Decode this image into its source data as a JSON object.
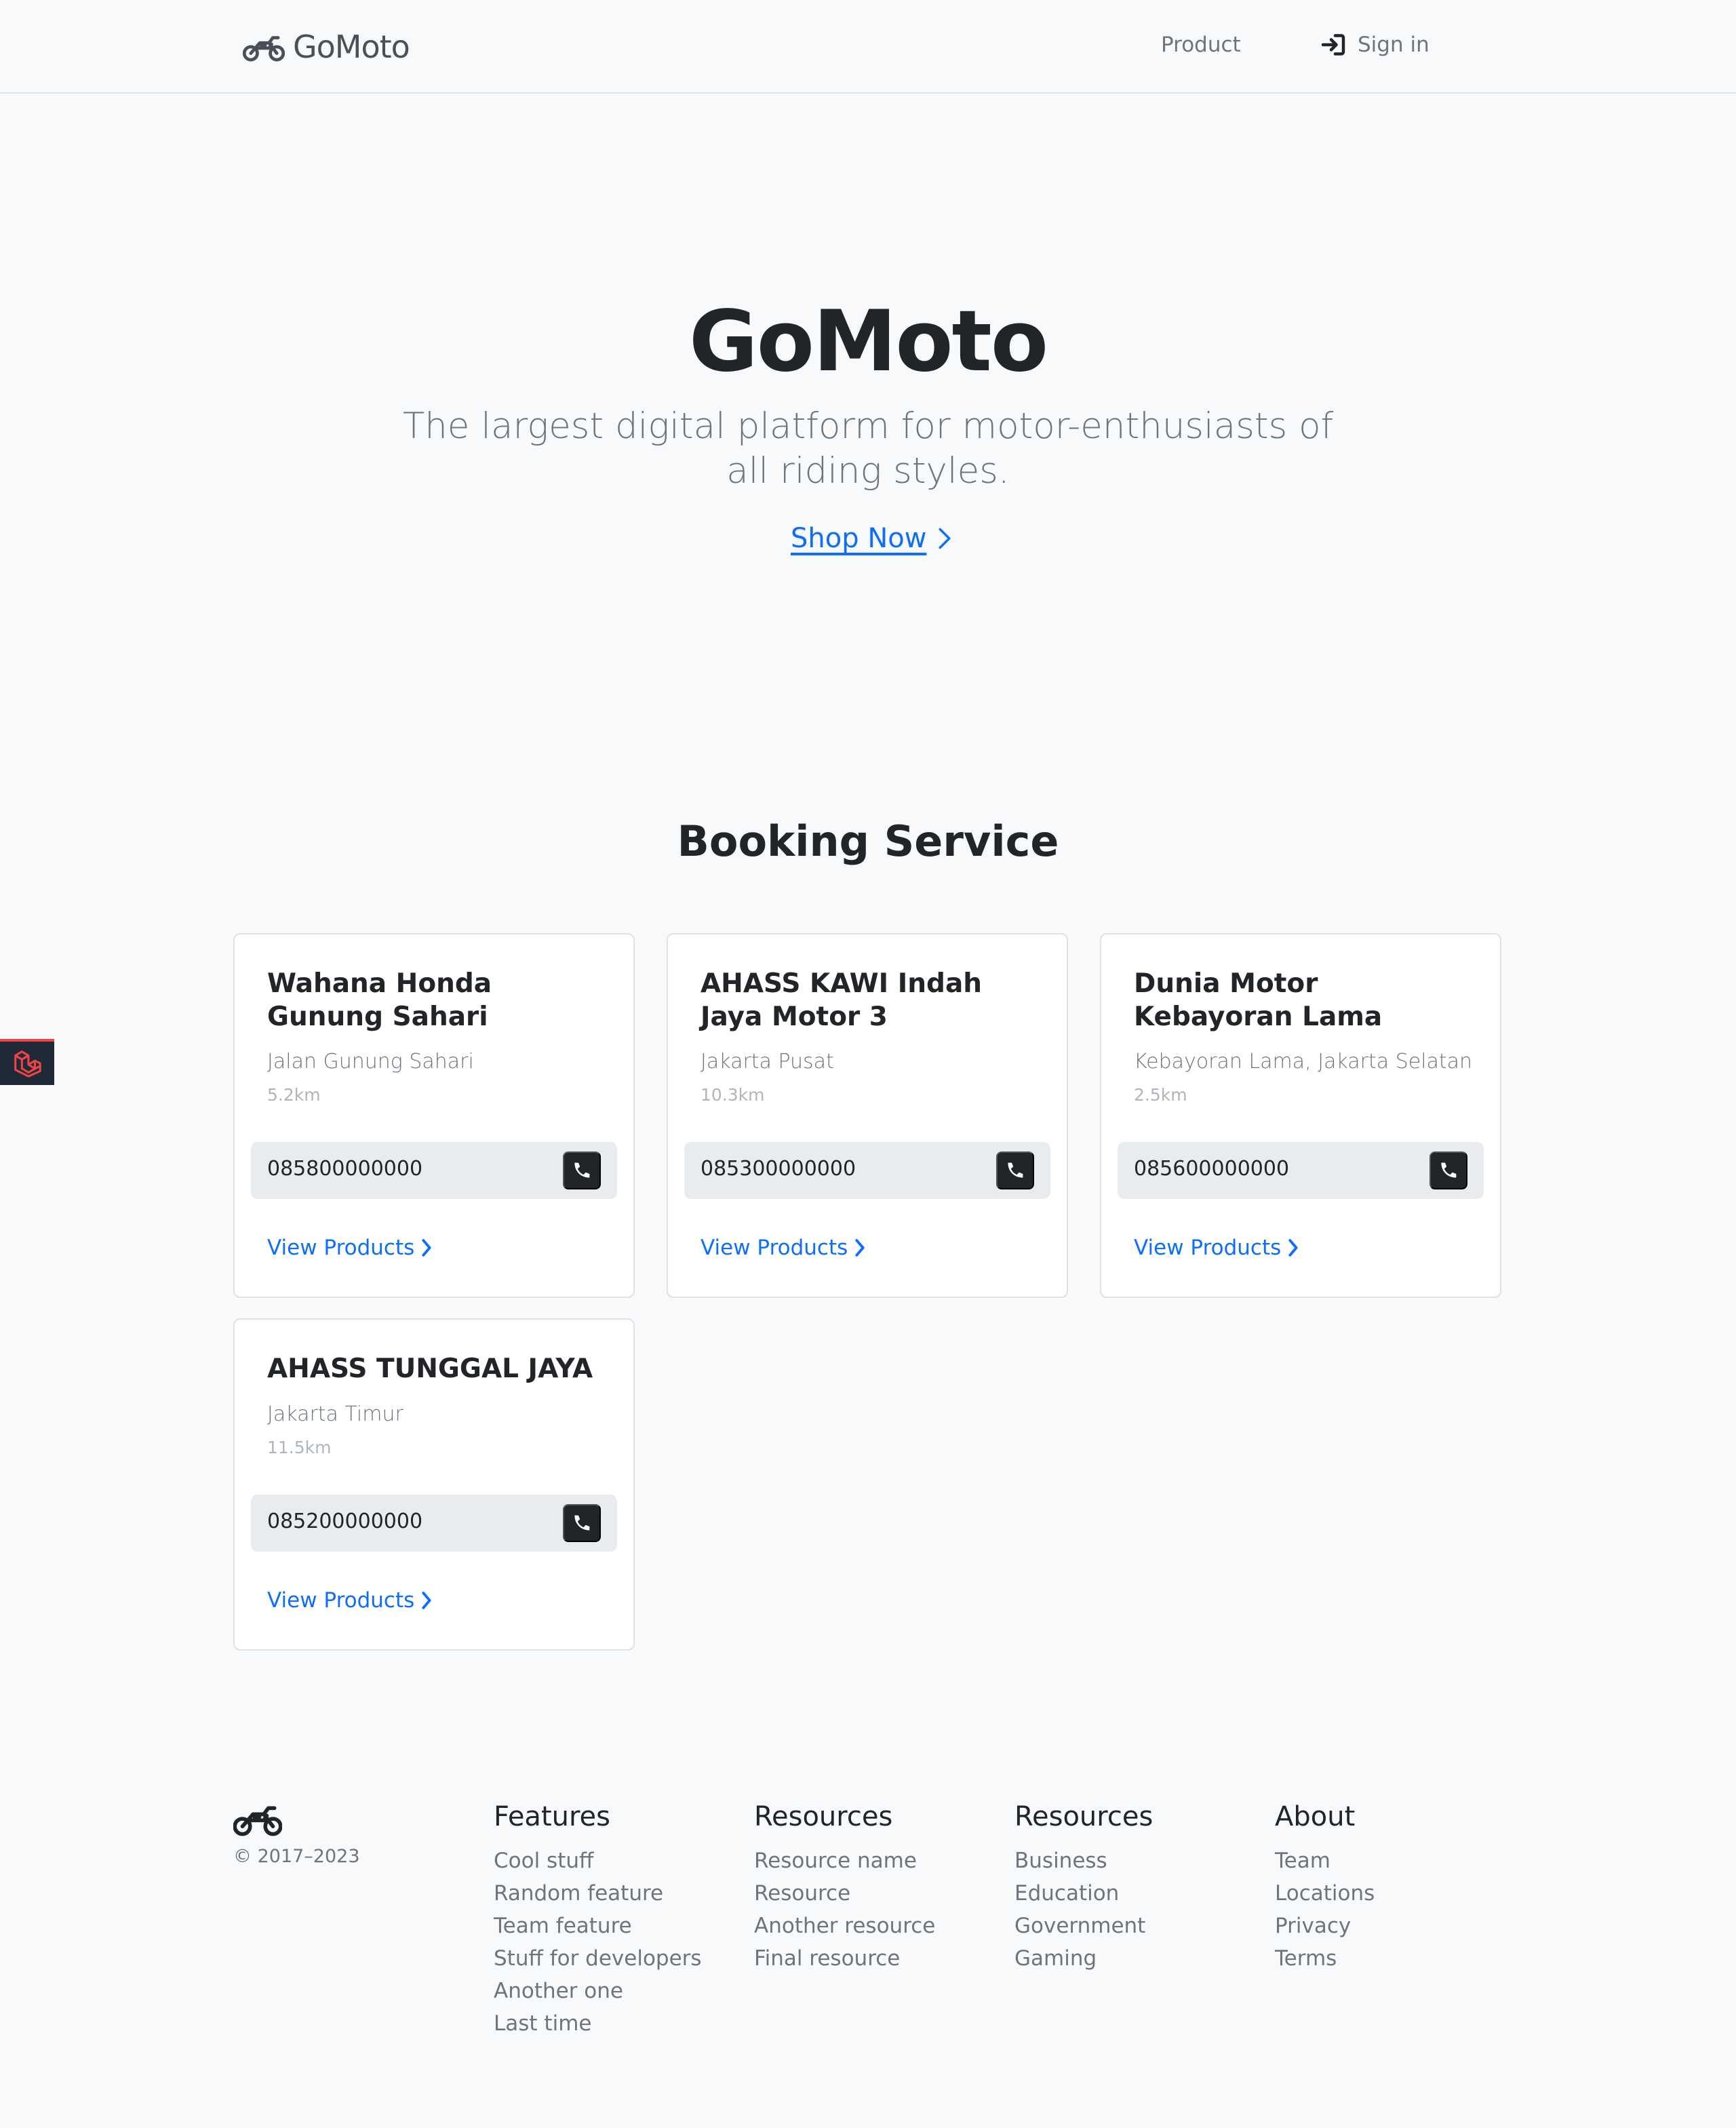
{
  "navbar": {
    "brand": "GoMoto",
    "brand_icon": "motorcycle-icon",
    "links": [
      {
        "label": "Product"
      },
      {
        "label": "Sign in",
        "icon": "sign-in-icon"
      }
    ]
  },
  "hero": {
    "title": "GoMoto",
    "lead": "The largest digital platform for motor-enthusiasts of all riding styles.",
    "cta": "Shop Now",
    "cta_icon": "chevron-right-icon"
  },
  "booking": {
    "title": "Booking Service",
    "cards": [
      {
        "name": "Wahana Honda Gunung Sahari",
        "address": "Jalan Gunung Sahari",
        "distance": "5.2km",
        "phone": "085800000000",
        "link": "View Products"
      },
      {
        "name": "AHASS KAWI Indah Jaya Motor 3",
        "address": "Jakarta Pusat",
        "distance": "10.3km",
        "phone": "085300000000",
        "link": "View Products"
      },
      {
        "name": "Dunia Motor Kebayoran Lama",
        "address": "Kebayoran Lama, Jakarta Selatan",
        "distance": "2.5km",
        "phone": "085600000000",
        "link": "View Products"
      },
      {
        "name": "AHASS TUNGGAL JAYA",
        "address": "Jakarta Timur",
        "distance": "11.5km",
        "phone": "085200000000",
        "link": "View Products"
      }
    ]
  },
  "footer": {
    "copyright": "© 2017–2023",
    "columns": [
      {
        "title": "Features",
        "items": [
          "Cool stuff",
          "Random feature",
          "Team feature",
          "Stuff for developers",
          "Another one",
          "Last time"
        ]
      },
      {
        "title": "Resources",
        "items": [
          "Resource name",
          "Resource",
          "Another resource",
          "Final resource"
        ]
      },
      {
        "title": "Resources",
        "items": [
          "Business",
          "Education",
          "Government",
          "Gaming"
        ]
      },
      {
        "title": "About",
        "items": [
          "Team",
          "Locations",
          "Privacy",
          "Terms"
        ]
      }
    ]
  },
  "colors": {
    "background": "#f8f9fa",
    "link": "#0d6efd",
    "dark": "#212529",
    "muted": "#6c757d"
  }
}
